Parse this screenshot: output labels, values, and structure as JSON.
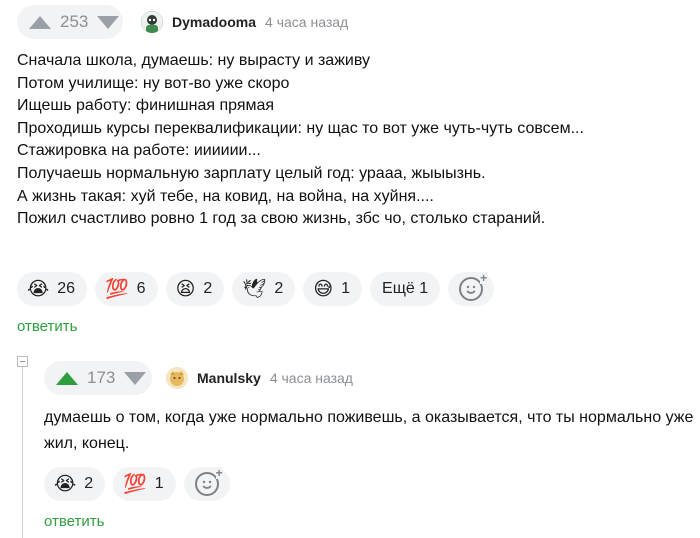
{
  "comment1": {
    "rating": "253",
    "author": "Dymadooma",
    "time": "4 часа назад",
    "lines": [
      "Сначала школа, думаешь: ну вырасту и заживу",
      "Потом училище: ну вот-во уже скоро",
      "Ищешь работу: финишная прямая",
      "Проходишь курсы переквалификации: ну щас то вот уже чуть-чуть совсем...",
      "Стажировка на работе: ииииии...",
      "Получаешь нормальную зарплату целый год: урааа, жыыызнь.",
      "А жизнь такая: хуй тебе, на ковид, на война, на хуйня....",
      "Пожил счастливо ровно 1 год за свою жизнь, збс чо, столько стараний."
    ],
    "reactions": [
      {
        "icon": "crying-face-icon",
        "glyph": "😭",
        "count": "26"
      },
      {
        "icon": "hundred-points-icon",
        "glyph": "💯",
        "count": "6"
      },
      {
        "icon": "tired-face-icon",
        "glyph": "😫",
        "count": "2"
      },
      {
        "icon": "dove-icon",
        "glyph": "🕊",
        "count": "2"
      },
      {
        "icon": "grinning-sweat-face-icon",
        "glyph": "😅",
        "count": "1"
      }
    ],
    "more_label": "Ещё 1",
    "reply_label": "ответить"
  },
  "comment2": {
    "rating": "173",
    "author": "Manulsky",
    "time": "4 часа назад",
    "lines": [
      "думаешь о том, когда уже нормально поживешь, а оказывается, что ты нормально уже",
      "жил, конец."
    ],
    "reactions": [
      {
        "icon": "crying-face-icon",
        "glyph": "😭",
        "count": "2"
      },
      {
        "icon": "hundred-points-icon",
        "glyph": "💯",
        "count": "1"
      }
    ],
    "reply_label": "ответить"
  },
  "colors": {
    "accent_green": "#2e9e3e",
    "muted_gray": "#8c8f94",
    "pill_bg": "#f2f3f4"
  }
}
